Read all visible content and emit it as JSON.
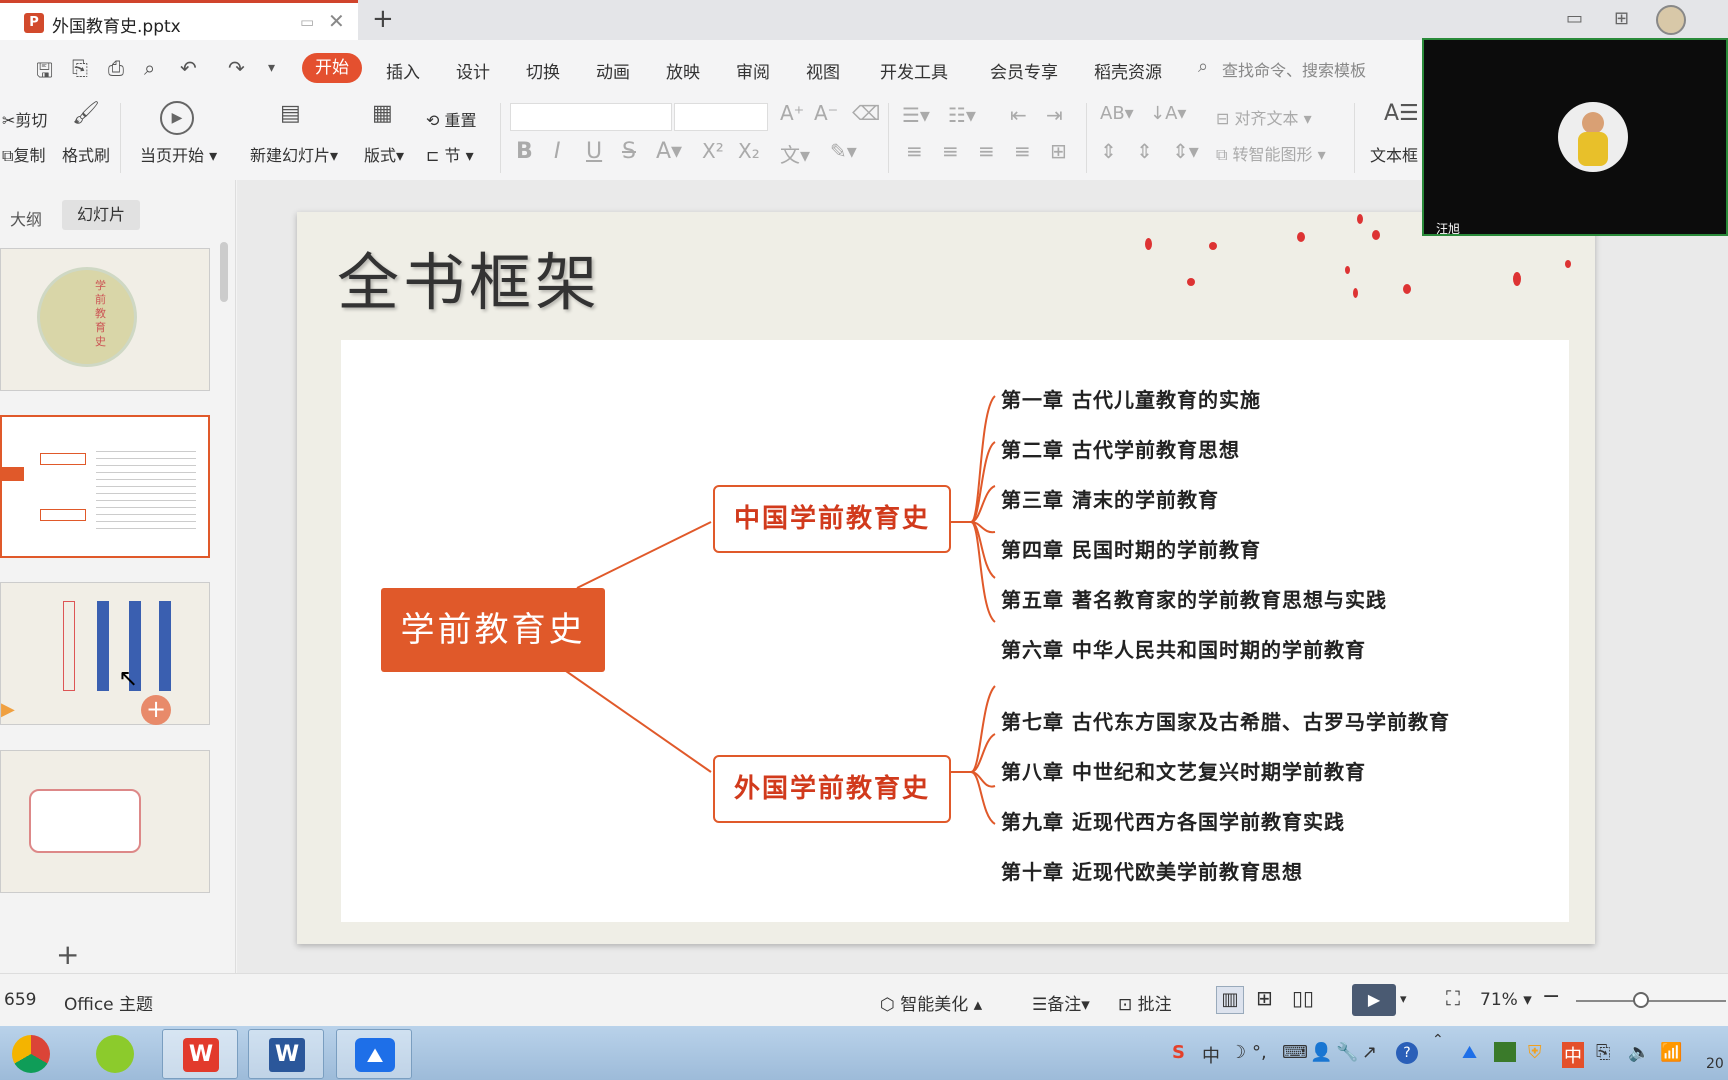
{
  "window": {
    "tab_title": "外国教育史.pptx",
    "new_tab": "+"
  },
  "menu": {
    "items": [
      "开始",
      "插入",
      "设计",
      "切换",
      "动画",
      "放映",
      "审阅",
      "视图",
      "开发工具",
      "会员专享",
      "稻壳资源"
    ],
    "search": "查找命令、搜索模板"
  },
  "ribbon": {
    "cut": "剪切",
    "copy": "复制",
    "format_painter": "格式刷",
    "from_current": "当页开始",
    "new_slide": "新建幻灯片",
    "layout": "版式",
    "reset": "重置",
    "section": "节",
    "align_text": "对齐文本",
    "smart_shape": "转智能图形",
    "textbox": "文本框"
  },
  "sidebar": {
    "tab_outline": "大纲",
    "tab_slides": "幻灯片",
    "add": "+"
  },
  "slide": {
    "title": "全书框架",
    "root": "学前教育史",
    "branch1": "中国学前教育史",
    "branch2": "外国学前教育史",
    "chapters1": [
      "第一章  古代儿童教育的实施",
      "第二章  古代学前教育思想",
      "第三章  清末的学前教育",
      "第四章  民国时期的学前教育",
      "第五章  著名教育家的学前教育思想与实践",
      "第六章  中华人民共和国时期的学前教育"
    ],
    "chapters2": [
      "第七章  古代东方国家及古希腊、古罗马学前教育",
      "第八章  中世纪和文艺复兴时期学前教育",
      "第九章  近现代西方各国学前教育实践",
      "第十章  近现代欧美学前教育思想"
    ],
    "accent": "#e0592a"
  },
  "video": {
    "presenter": "汪旭"
  },
  "status": {
    "slide_info": "659",
    "theme": "Office 主题",
    "beautify": "智能美化",
    "notes": "备注",
    "comment": "批注",
    "zoom": "71%"
  },
  "taskbar": {
    "clock_partial": "20"
  }
}
